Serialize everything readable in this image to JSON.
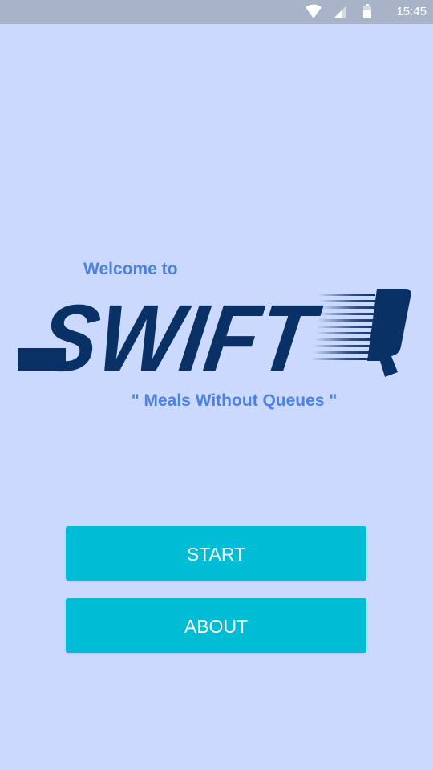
{
  "status_bar": {
    "time": "15:45",
    "icons": [
      "wifi-icon",
      "signal-icon",
      "battery-icon"
    ]
  },
  "main": {
    "welcome_text": "Welcome to",
    "logo_text": "SWIFTQ",
    "tagline": "\" Meals Without Queues \""
  },
  "buttons": {
    "start_label": "START",
    "about_label": "ABOUT"
  },
  "colors": {
    "background": "#cad9fd",
    "status_bar": "#a8b3c8",
    "accent_text": "#4e82e0",
    "logo": "#0a3166",
    "button": "#00bcd4"
  }
}
